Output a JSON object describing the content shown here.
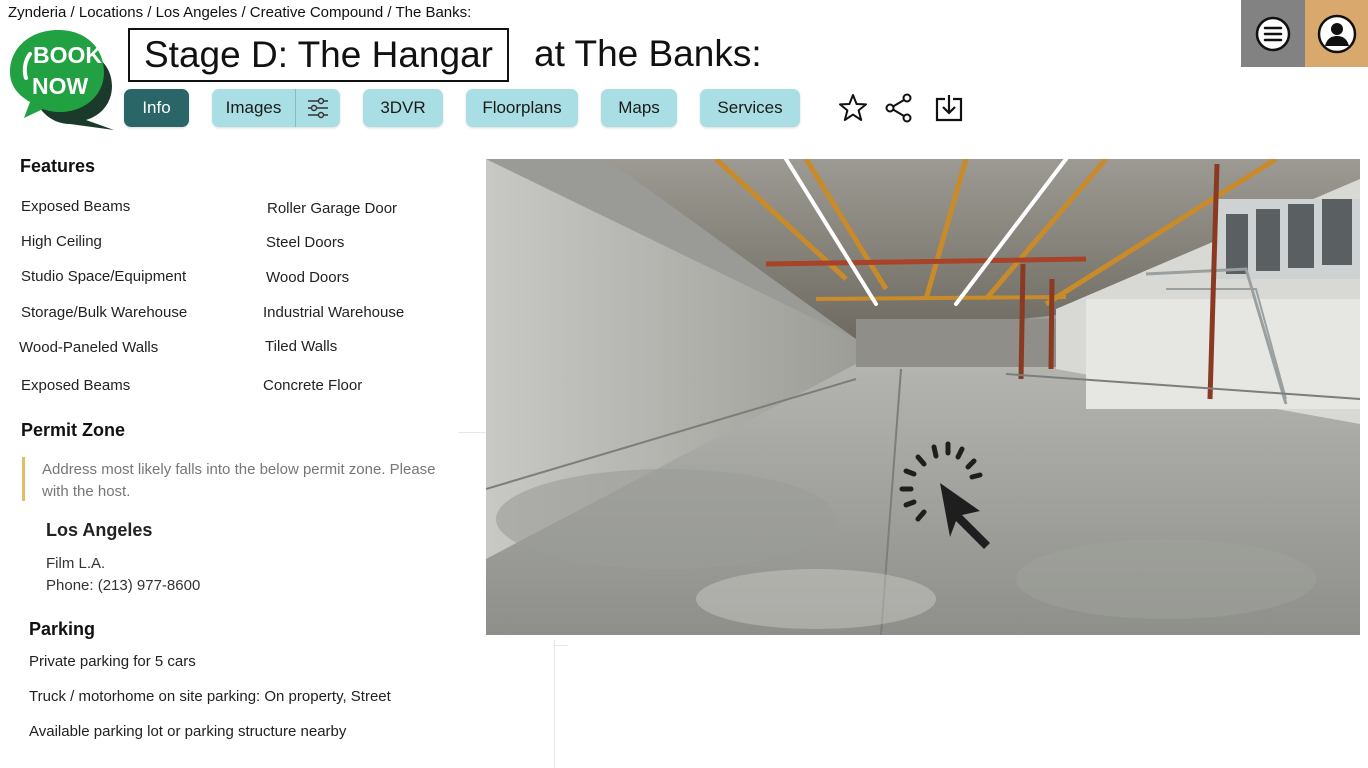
{
  "breadcrumb": "Zynderia / Locations / Los Angeles / Creative Compound / The Banks:",
  "book_now": {
    "line1": "BOOK",
    "line2": "NOW",
    "colors": {
      "bubble_green": "#1f9b3b",
      "bubble_dark": "#1b3a2b"
    }
  },
  "title": {
    "main": "Stage D: The Hangar",
    "suffix": "at The Banks:"
  },
  "tabs": [
    {
      "label": "Info",
      "active": true
    },
    {
      "label": "Images",
      "active": false
    },
    {
      "label": "3DVR",
      "active": false
    },
    {
      "label": "Floorplans",
      "active": false
    },
    {
      "label": "Maps",
      "active": false
    },
    {
      "label": "Services",
      "active": false
    }
  ],
  "icons": {
    "filter": "sliders-icon",
    "favorite": "star-icon",
    "share": "share-icon",
    "download": "download-icon",
    "menu": "hamburger-menu-icon",
    "user": "user-avatar-icon",
    "viewer_cursor": "click-cursor-icon"
  },
  "features": {
    "heading": "Features",
    "left": [
      "Exposed Beams",
      "High Ceiling",
      "Studio Space/Equipment",
      "Storage/Bulk Warehouse",
      "Wood-Paneled Walls",
      "Exposed Beams"
    ],
    "right": [
      "Roller Garage Door",
      "Steel Doors",
      "Wood Doors",
      "Industrial Warehouse",
      "Tiled Walls",
      "Concrete Floor"
    ]
  },
  "permit": {
    "heading": "Permit Zone",
    "note": "Address most likely falls into the below permit zone. Please with the host.",
    "city": "Los Angeles",
    "office": "Film L.A.",
    "phone": "Phone: (213) 977-8600"
  },
  "parking": {
    "heading": "Parking",
    "items": [
      "Private parking for 5 cars",
      "Truck / motorhome on site parking: On property, Street",
      "Available parking lot or parking structure nearby"
    ]
  },
  "colors": {
    "tab_bg": "#a9dfe4",
    "tab_active_bg": "#2a6567",
    "menu_bg": "#828282",
    "user_bg": "#d9a86c",
    "permit_accent": "#e7b96a"
  }
}
